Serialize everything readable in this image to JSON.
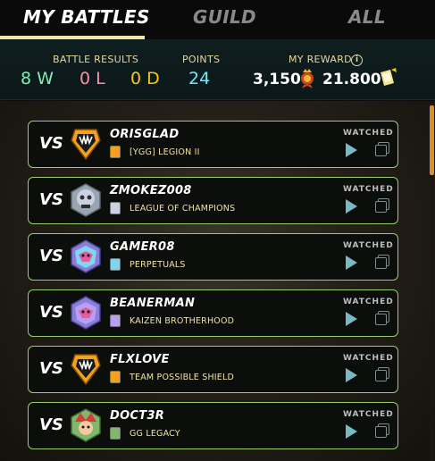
{
  "tabs": [
    {
      "label": "MY BATTLES",
      "active": true
    },
    {
      "label": "GUILD",
      "active": false
    },
    {
      "label": "ALL",
      "active": false
    }
  ],
  "summary": {
    "battle_results_label": "BATTLE RESULTS",
    "wins": "8 W",
    "losses": "0 L",
    "draws": "0 D",
    "points_label": "POINTS",
    "points": "24",
    "reward_label": "MY REWARD",
    "reward_amount_1": "3,150",
    "reward_amount_2": "21.800"
  },
  "battles": [
    {
      "vs": "VS",
      "player": "ORISGLAD",
      "guild": "[YGG] LEGION II",
      "status": "WATCHED",
      "avatar": "fang-shield-icon",
      "avatar_color": "#f4a21c"
    },
    {
      "vs": "VS",
      "player": "ZMOKEZ008",
      "guild": "LEAGUE OF CHAMPIONS",
      "status": "WATCHED",
      "avatar": "skull-badge-icon",
      "avatar_color": "#c9d4e0"
    },
    {
      "vs": "VS",
      "player": "GAMER08",
      "guild": "PERPETUALS",
      "status": "WATCHED",
      "avatar": "dragon-badge-icon",
      "avatar_color": "#7fd6f0"
    },
    {
      "vs": "VS",
      "player": "BEANERMAN",
      "guild": "KAIZEN BROTHERHOOD",
      "status": "WATCHED",
      "avatar": "dragon-badge-icon",
      "avatar_color": "#b99ef5"
    },
    {
      "vs": "VS",
      "player": "FLXLOVE",
      "guild": "TEAM POSSIBLE SHIELD",
      "status": "WATCHED",
      "avatar": "fang-shield-icon",
      "avatar_color": "#f4a21c"
    },
    {
      "vs": "VS",
      "player": "DOCT3R",
      "guild": "GG LEGACY",
      "status": "WATCHED",
      "avatar": "jester-badge-icon",
      "avatar_color": "#7fb86a"
    }
  ]
}
